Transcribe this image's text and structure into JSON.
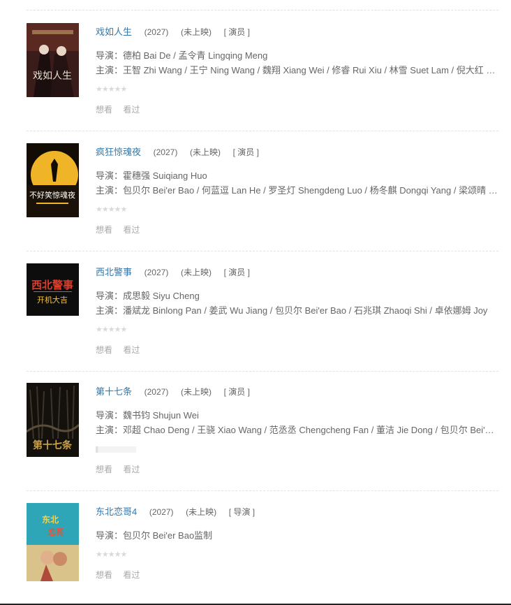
{
  "items": [
    {
      "title": "戏如人生",
      "year": "(2027)",
      "status": "(未上映)",
      "role": "[ 演员 ]",
      "director": "导演：德柏 Bai De / 孟令青 Lingqing Meng",
      "cast": "主演：王智 Zhi Wang / 王宁 Ning Wang / 魏翔 Xiang Wei / 修睿 Rui Xiu / 林雪 Suet Lam / 倪大红 Dahong Ni",
      "want": "想看",
      "seen": "看过",
      "poster_colors": [
        "#5a2a2a",
        "#2b1a1a",
        "#c9a06b"
      ]
    },
    {
      "title": "疯狂惊魂夜",
      "year": "(2027)",
      "status": "(未上映)",
      "role": "[ 演员 ]",
      "director": "导演：霍穗强 Suiqiang Huo",
      "cast": "主演：包贝尔 Bei'er Bao / 何蓝逗 Lan He / 罗圣灯 Shengdeng Luo / 杨冬麒 Dongqi Yang / 梁颂晴 Chung Ching Leung",
      "want": "想看",
      "seen": "看过",
      "poster_colors": [
        "#1a1208",
        "#f0b429",
        "#ffffff"
      ]
    },
    {
      "title": "西北警事",
      "year": "(2027)",
      "status": "(未上映)",
      "role": "[ 演员 ]",
      "director": "导演：成思毅 Siyu Cheng",
      "cast": "主演：潘斌龙 Binlong Pan / 姜武 Wu Jiang / 包贝尔 Bei'er Bao / 石兆琪 Zhaoqi Shi / 卓依娜姆 Joy",
      "want": "想看",
      "seen": "看过",
      "poster_colors": [
        "#0d0d0d",
        "#e23b2a",
        "#f5c542"
      ]
    },
    {
      "title": "第十七条",
      "year": "(2027)",
      "status": "(未上映)",
      "role": "[ 演员 ]",
      "director": "导演：魏书钧 Shujun Wei",
      "cast": "主演：邓超 Chao Deng / 王骁 Xiao Wang / 范丞丞 Chengcheng Fan / 董洁 Jie Dong / 包贝尔 Bei'er Bao",
      "want": "想看",
      "seen": "看过",
      "poster_colors": [
        "#14110c",
        "#caa24a",
        "#3b342a"
      ]
    },
    {
      "title": "东北恋哥4",
      "year": "(2027)",
      "status": "(未上映)",
      "role": "[ 导演 ]",
      "director": "导演：包贝尔 Bei'er Bao监制",
      "cast": "",
      "want": "想看",
      "seen": "看过",
      "poster_colors": [
        "#2fa6b8",
        "#f3d24a",
        "#e0573b"
      ]
    }
  ]
}
